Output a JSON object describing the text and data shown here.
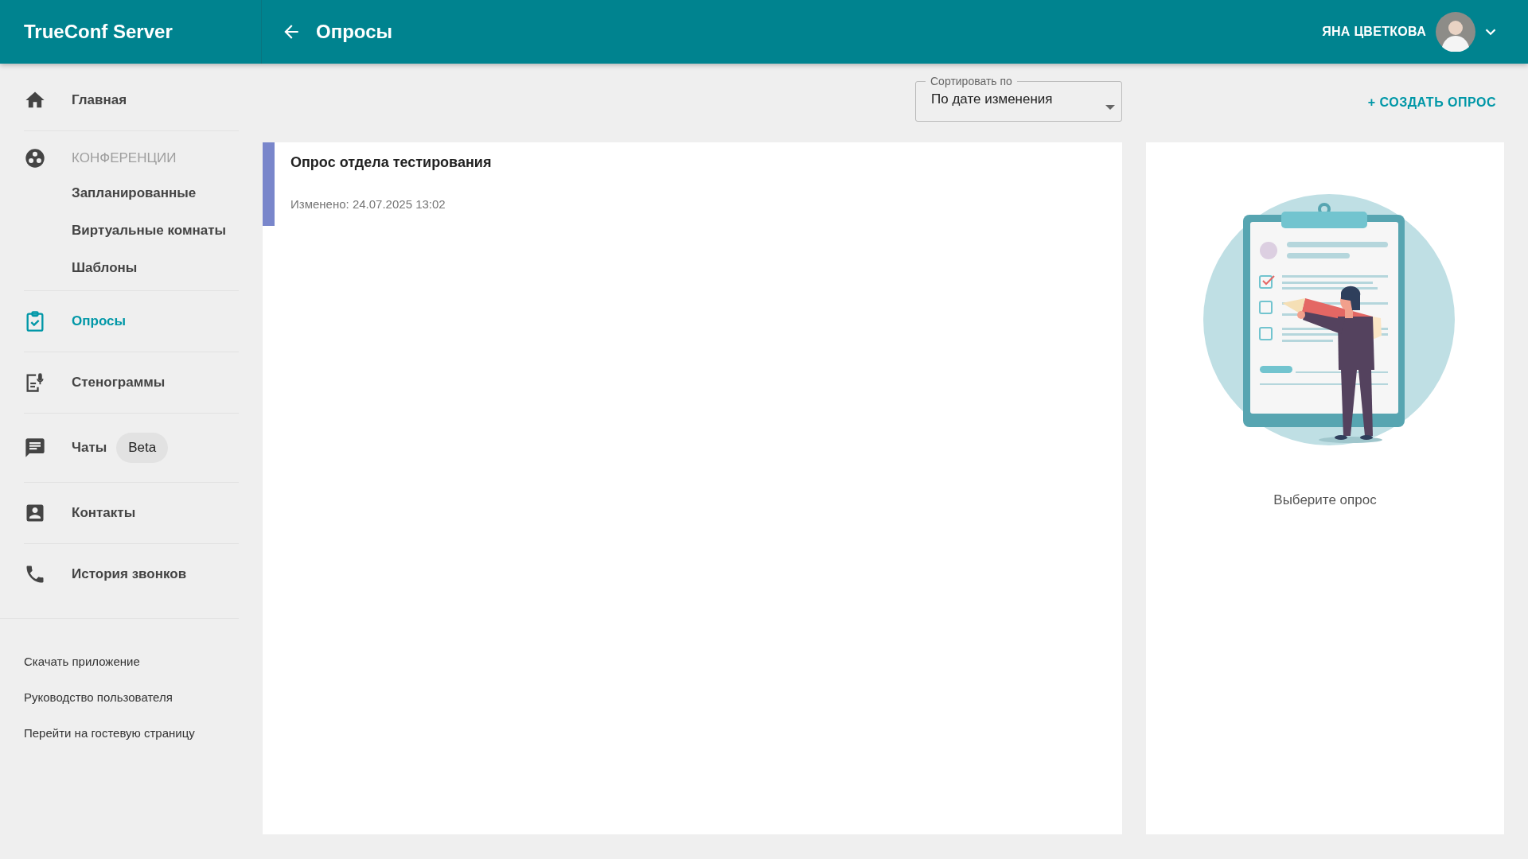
{
  "header": {
    "brand": "TrueConf Server",
    "page_title": "Опросы",
    "user_name": "ЯНА ЦВЕТКОВА"
  },
  "sidebar": {
    "items": [
      {
        "kind": "link",
        "label": "Главная",
        "selected": false
      },
      {
        "kind": "section",
        "label": "КОНФЕРЕНЦИИ",
        "children": [
          {
            "label": "Запланированные",
            "selected": false
          },
          {
            "label": "Виртуальные комнаты",
            "selected": false
          },
          {
            "label": "Шаблоны",
            "selected": false
          }
        ]
      },
      {
        "kind": "link",
        "label": "Опросы",
        "selected": true
      },
      {
        "kind": "link",
        "label": "Стенограммы",
        "selected": false
      },
      {
        "kind": "link",
        "label": "Чаты",
        "badge": "Beta",
        "selected": false
      },
      {
        "kind": "link",
        "label": "Контакты",
        "selected": false
      },
      {
        "kind": "link",
        "label": "История звонков",
        "selected": false
      }
    ],
    "footer_links": [
      "Скачать приложение",
      "Руководство пользователя",
      "Перейти на гостевую страницу"
    ]
  },
  "toolbar": {
    "sort": {
      "label": "Сортировать по",
      "value": "По дате изменения"
    },
    "create_button": "+ СОЗДАТЬ ОПРОС"
  },
  "polls": [
    {
      "title": "Опрос отдела тестирования",
      "modified": "Изменено: 24.07.2025 13:02",
      "color": "#7986cb"
    }
  ],
  "detail": {
    "empty_text": "Выберите опрос"
  }
}
